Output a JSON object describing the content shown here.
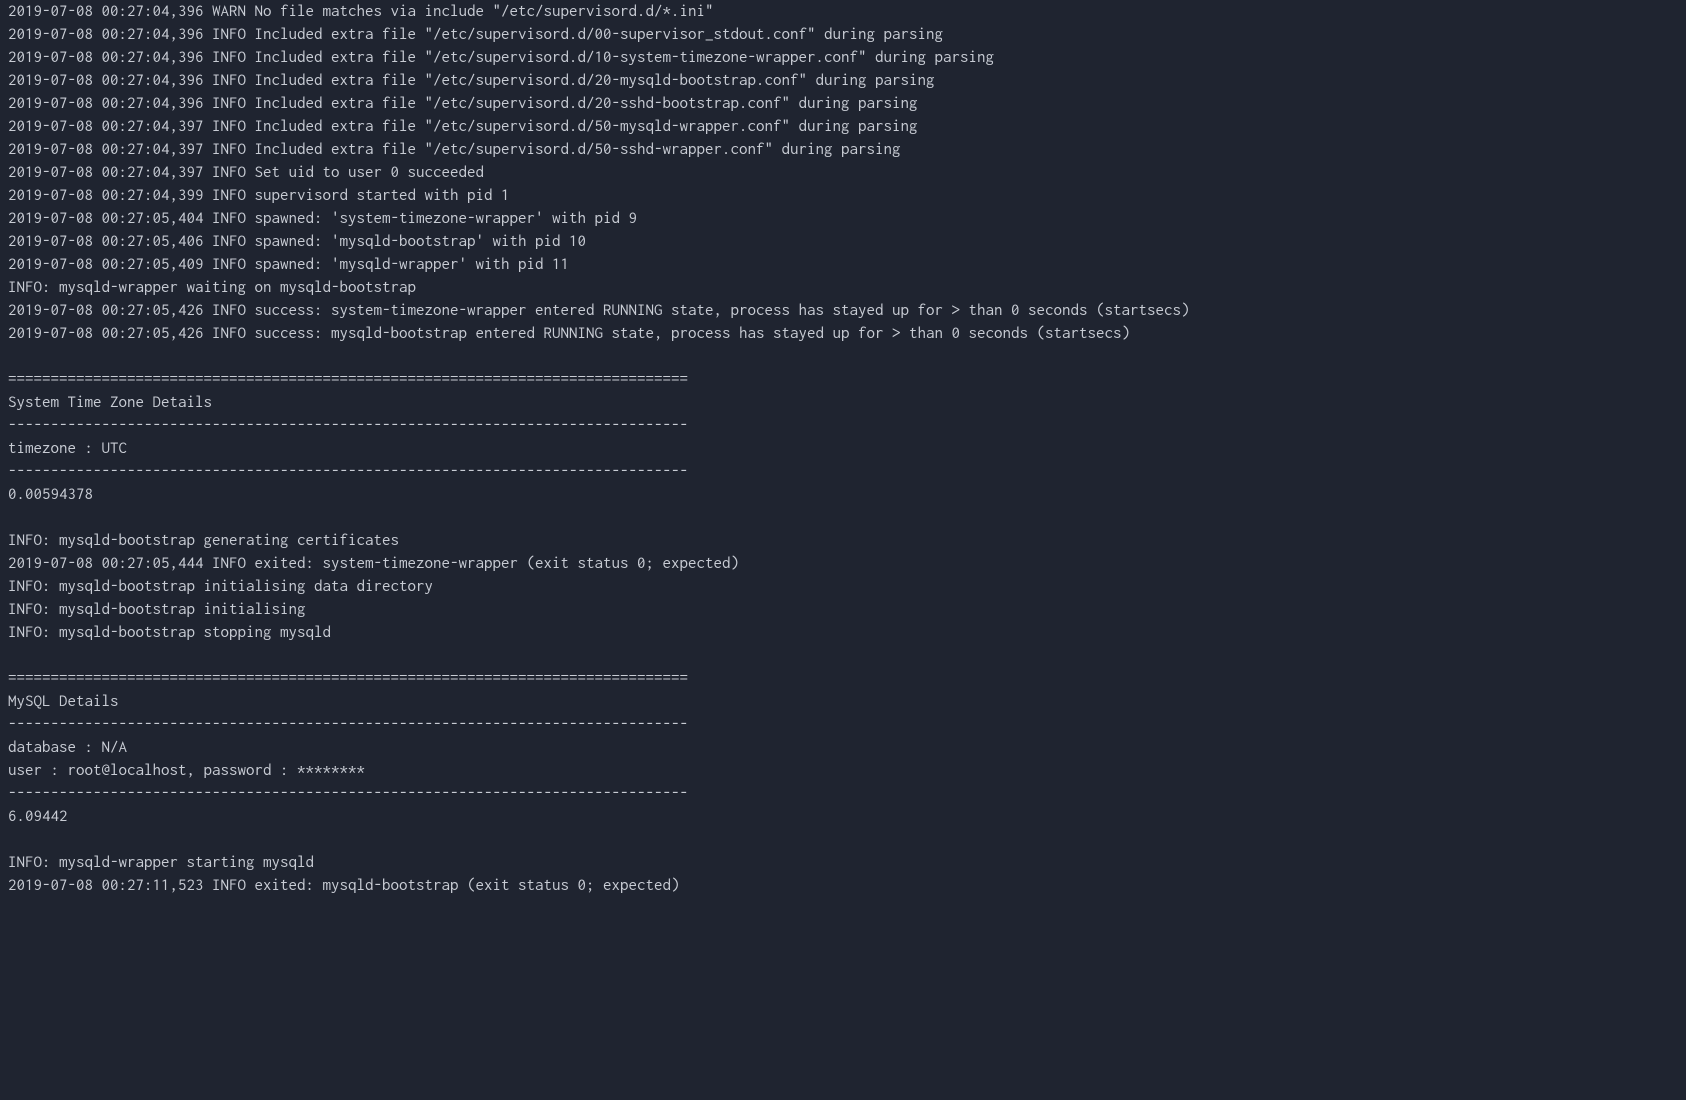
{
  "lines": [
    "2019-07-08 00:27:04,396 WARN No file matches via include \"/etc/supervisord.d/*.ini\"",
    "2019-07-08 00:27:04,396 INFO Included extra file \"/etc/supervisord.d/00-supervisor_stdout.conf\" during parsing",
    "2019-07-08 00:27:04,396 INFO Included extra file \"/etc/supervisord.d/10-system-timezone-wrapper.conf\" during parsing",
    "2019-07-08 00:27:04,396 INFO Included extra file \"/etc/supervisord.d/20-mysqld-bootstrap.conf\" during parsing",
    "2019-07-08 00:27:04,396 INFO Included extra file \"/etc/supervisord.d/20-sshd-bootstrap.conf\" during parsing",
    "2019-07-08 00:27:04,397 INFO Included extra file \"/etc/supervisord.d/50-mysqld-wrapper.conf\" during parsing",
    "2019-07-08 00:27:04,397 INFO Included extra file \"/etc/supervisord.d/50-sshd-wrapper.conf\" during parsing",
    "2019-07-08 00:27:04,397 INFO Set uid to user 0 succeeded",
    "2019-07-08 00:27:04,399 INFO supervisord started with pid 1",
    "2019-07-08 00:27:05,404 INFO spawned: 'system-timezone-wrapper' with pid 9",
    "2019-07-08 00:27:05,406 INFO spawned: 'mysqld-bootstrap' with pid 10",
    "2019-07-08 00:27:05,409 INFO spawned: 'mysqld-wrapper' with pid 11",
    "INFO: mysqld-wrapper waiting on mysqld-bootstrap",
    "2019-07-08 00:27:05,426 INFO success: system-timezone-wrapper entered RUNNING state, process has stayed up for > than 0 seconds (startsecs)",
    "2019-07-08 00:27:05,426 INFO success: mysqld-bootstrap entered RUNNING state, process has stayed up for > than 0 seconds (startsecs)",
    "",
    "================================================================================",
    "System Time Zone Details",
    "--------------------------------------------------------------------------------",
    "timezone : UTC",
    "--------------------------------------------------------------------------------",
    "0.00594378",
    "",
    "INFO: mysqld-bootstrap generating certificates",
    "2019-07-08 00:27:05,444 INFO exited: system-timezone-wrapper (exit status 0; expected)",
    "INFO: mysqld-bootstrap initialising data directory",
    "INFO: mysqld-bootstrap initialising",
    "INFO: mysqld-bootstrap stopping mysqld",
    "",
    "================================================================================",
    "MySQL Details",
    "--------------------------------------------------------------------------------",
    "database : N/A",
    "user : root@localhost, password : ********",
    "--------------------------------------------------------------------------------",
    "6.09442",
    "",
    "INFO: mysqld-wrapper starting mysqld",
    "2019-07-08 00:27:11,523 INFO exited: mysqld-bootstrap (exit status 0; expected)"
  ]
}
